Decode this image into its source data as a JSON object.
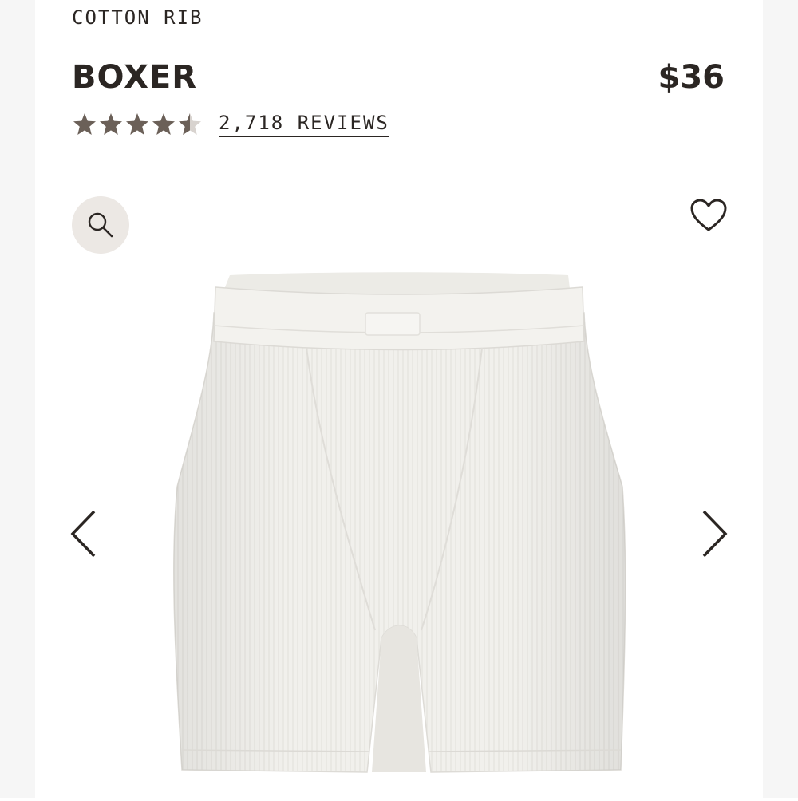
{
  "product": {
    "collection": "COTTON RIB",
    "name": "BOXER",
    "price": "$36",
    "rating": 4.5,
    "reviews_label": "2,718 REVIEWS"
  },
  "gallery": {
    "image_alt": "Boxer product image",
    "zoom_icon": "search-icon",
    "wishlist_icon": "heart-icon",
    "prev_icon": "chevron-left-icon",
    "next_icon": "chevron-right-icon"
  },
  "colors": {
    "text": "#2b2623",
    "star": "#6b6058",
    "zoom_bg": "#ece8e4",
    "fabric": "#f1f0ec"
  }
}
